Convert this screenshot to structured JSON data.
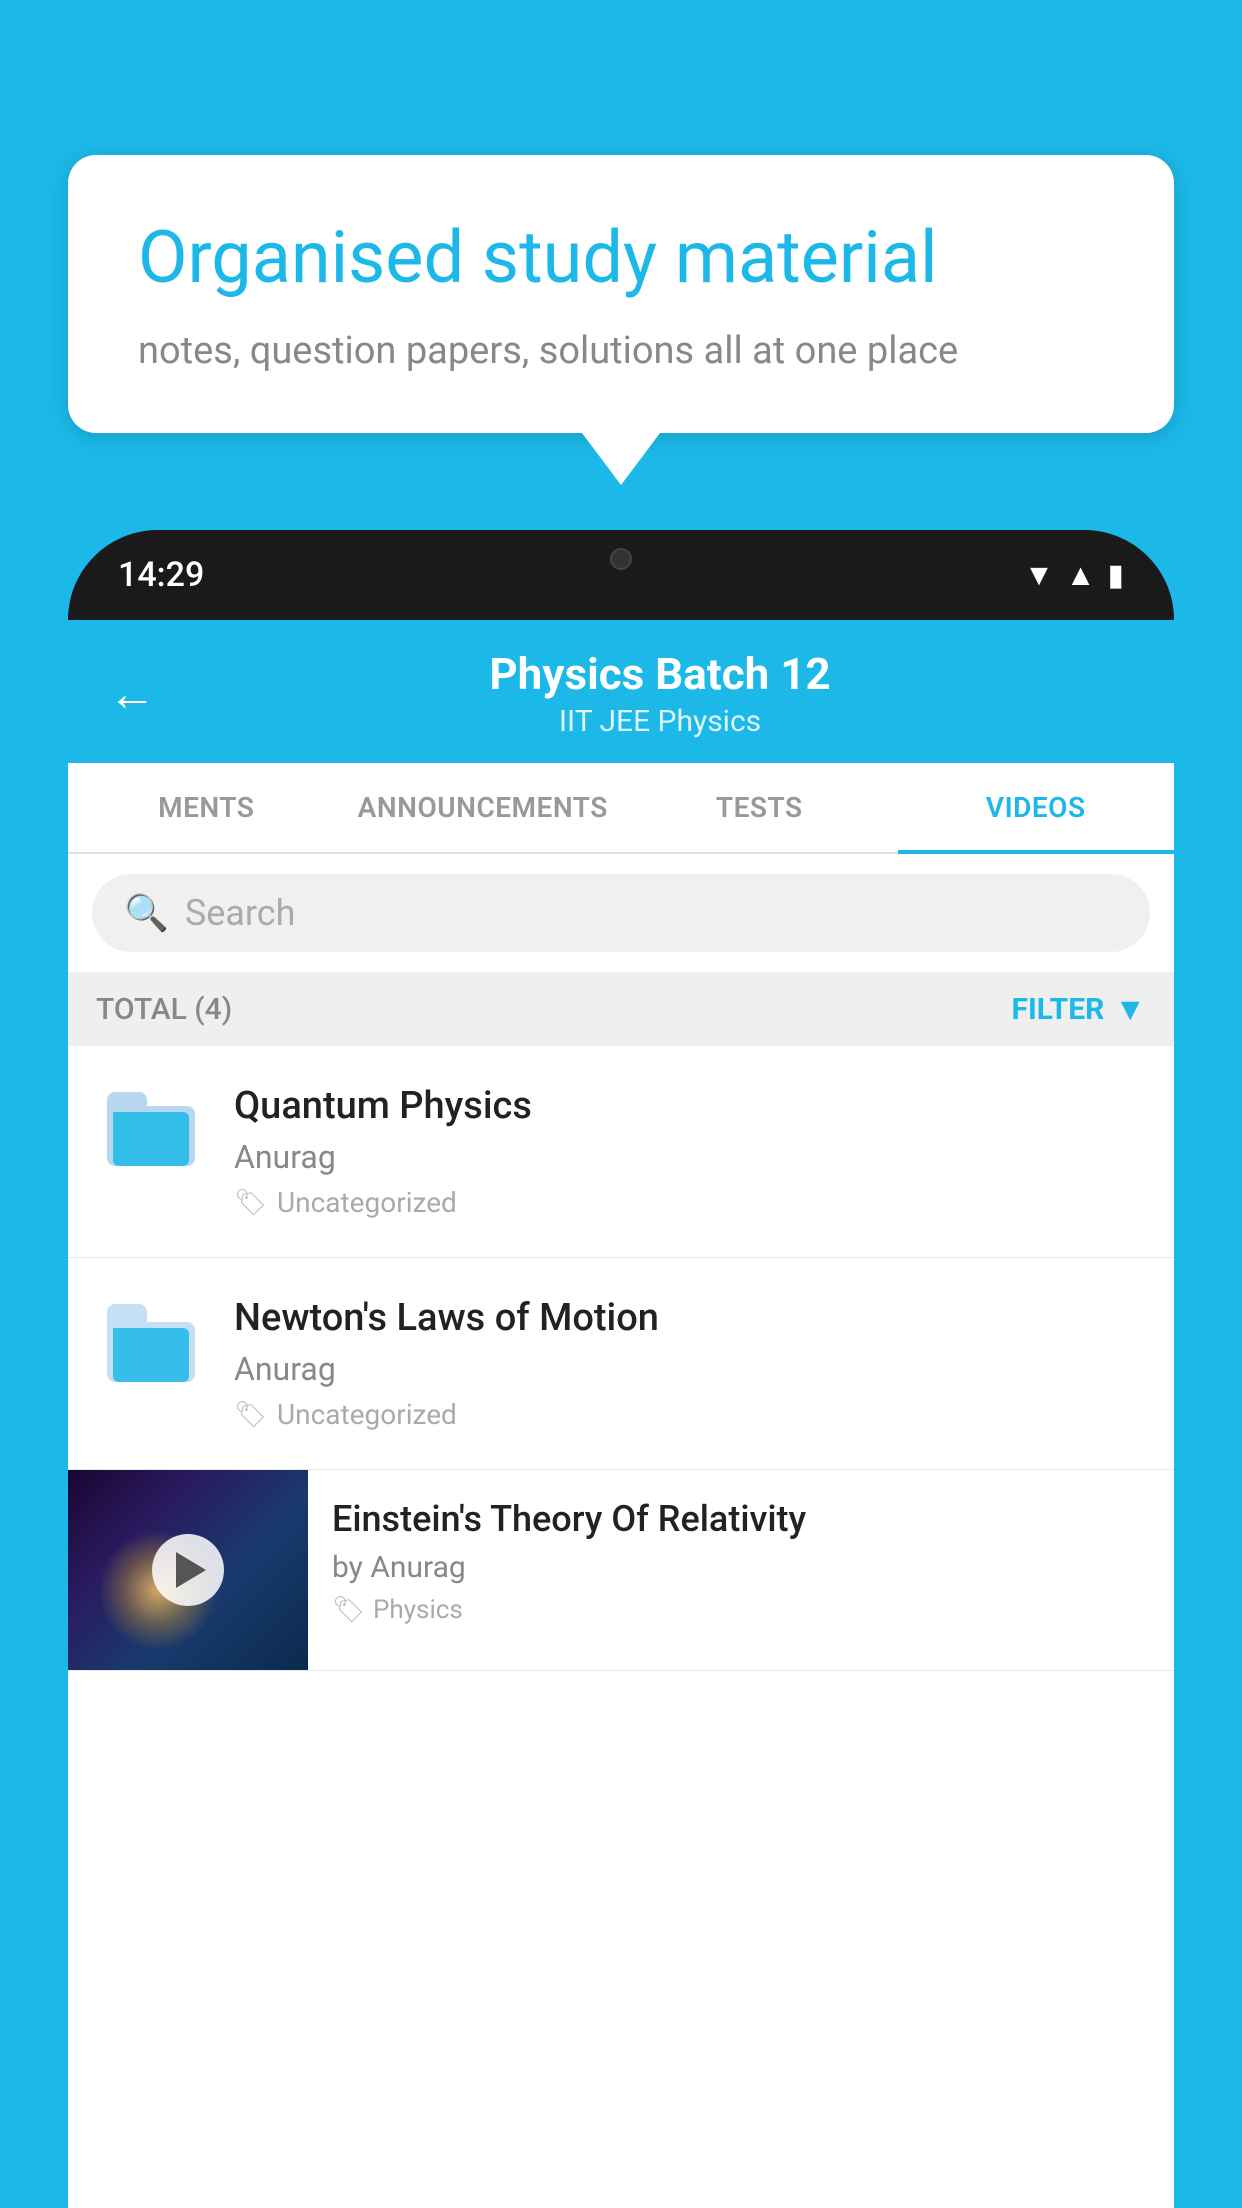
{
  "background_color": "#1bb8e8",
  "speech_bubble": {
    "title": "Organised study material",
    "subtitle": "notes, question papers, solutions all at one place"
  },
  "phone": {
    "time": "14:29",
    "header": {
      "title": "Physics Batch 12",
      "subtitle": "IIT JEE   Physics",
      "back_label": "←"
    },
    "tabs": [
      {
        "label": "MENTS",
        "active": false
      },
      {
        "label": "ANNOUNCEMENTS",
        "active": false
      },
      {
        "label": "TESTS",
        "active": false
      },
      {
        "label": "VIDEOS",
        "active": true
      }
    ],
    "search": {
      "placeholder": "Search"
    },
    "filter_bar": {
      "total_label": "TOTAL (4)",
      "filter_label": "FILTER"
    },
    "videos": [
      {
        "title": "Quantum Physics",
        "author": "Anurag",
        "tag": "Uncategorized",
        "type": "folder"
      },
      {
        "title": "Newton's Laws of Motion",
        "author": "Anurag",
        "tag": "Uncategorized",
        "type": "folder"
      },
      {
        "title": "Einstein's Theory Of Relativity",
        "author": "by Anurag",
        "tag": "Physics",
        "type": "video"
      }
    ]
  }
}
